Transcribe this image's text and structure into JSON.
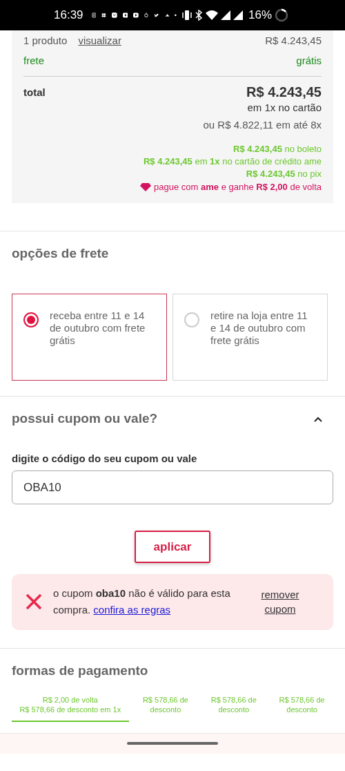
{
  "status_bar": {
    "time": "16:39",
    "battery": "16%"
  },
  "summary": {
    "products": "1 produto",
    "view_link": "visualizar",
    "products_price": "R$ 4.243,45",
    "shipping_label": "frete",
    "shipping_value": "grátis",
    "total_label": "total",
    "total_value": "R$ 4.243,45",
    "installment": "em 1x no cartão",
    "installment_alt": "ou R$ 4.822,11 em até 8x",
    "offers": [
      "**R$ 4.243,45** no boleto",
      "**R$ 4.243,45** em **1x** no cartão de crédito ame",
      "**R$ 4.243,45** no pix"
    ],
    "ame_offer": "pague com **ame** e ganhe **R$ 2,00** de volta"
  },
  "shipping": {
    "title": "opções de frete",
    "options": [
      {
        "text": "receba entre 11 e 14 de outubro com frete grátis",
        "selected": true
      },
      {
        "text": "retire na loja entre 11 e 14 de outubro com frete grátis",
        "selected": false
      }
    ]
  },
  "coupon": {
    "title": "possui cupom ou vale?",
    "expanded": true,
    "label": "digite o código do seu cupom ou vale",
    "value": "OBA10",
    "apply": "aplicar",
    "error": {
      "message": "o cupom **oba10** não é válido para esta compra.",
      "link": "confira as regras",
      "remove": "remover cupom"
    }
  },
  "payment": {
    "title": "formas de pagamento",
    "tabs": [
      {
        "lines": [
          "R$ 2,00 de volta",
          "R$ 578,66 de desconto em 1x"
        ],
        "selected": true
      },
      {
        "lines": [
          "R$ 578,66 de desconto"
        ],
        "selected": false
      },
      {
        "lines": [
          "R$ 578,66 de desconto"
        ],
        "selected": false
      },
      {
        "lines": [
          "R$ 578,66 de desconto"
        ],
        "selected": false
      }
    ]
  }
}
